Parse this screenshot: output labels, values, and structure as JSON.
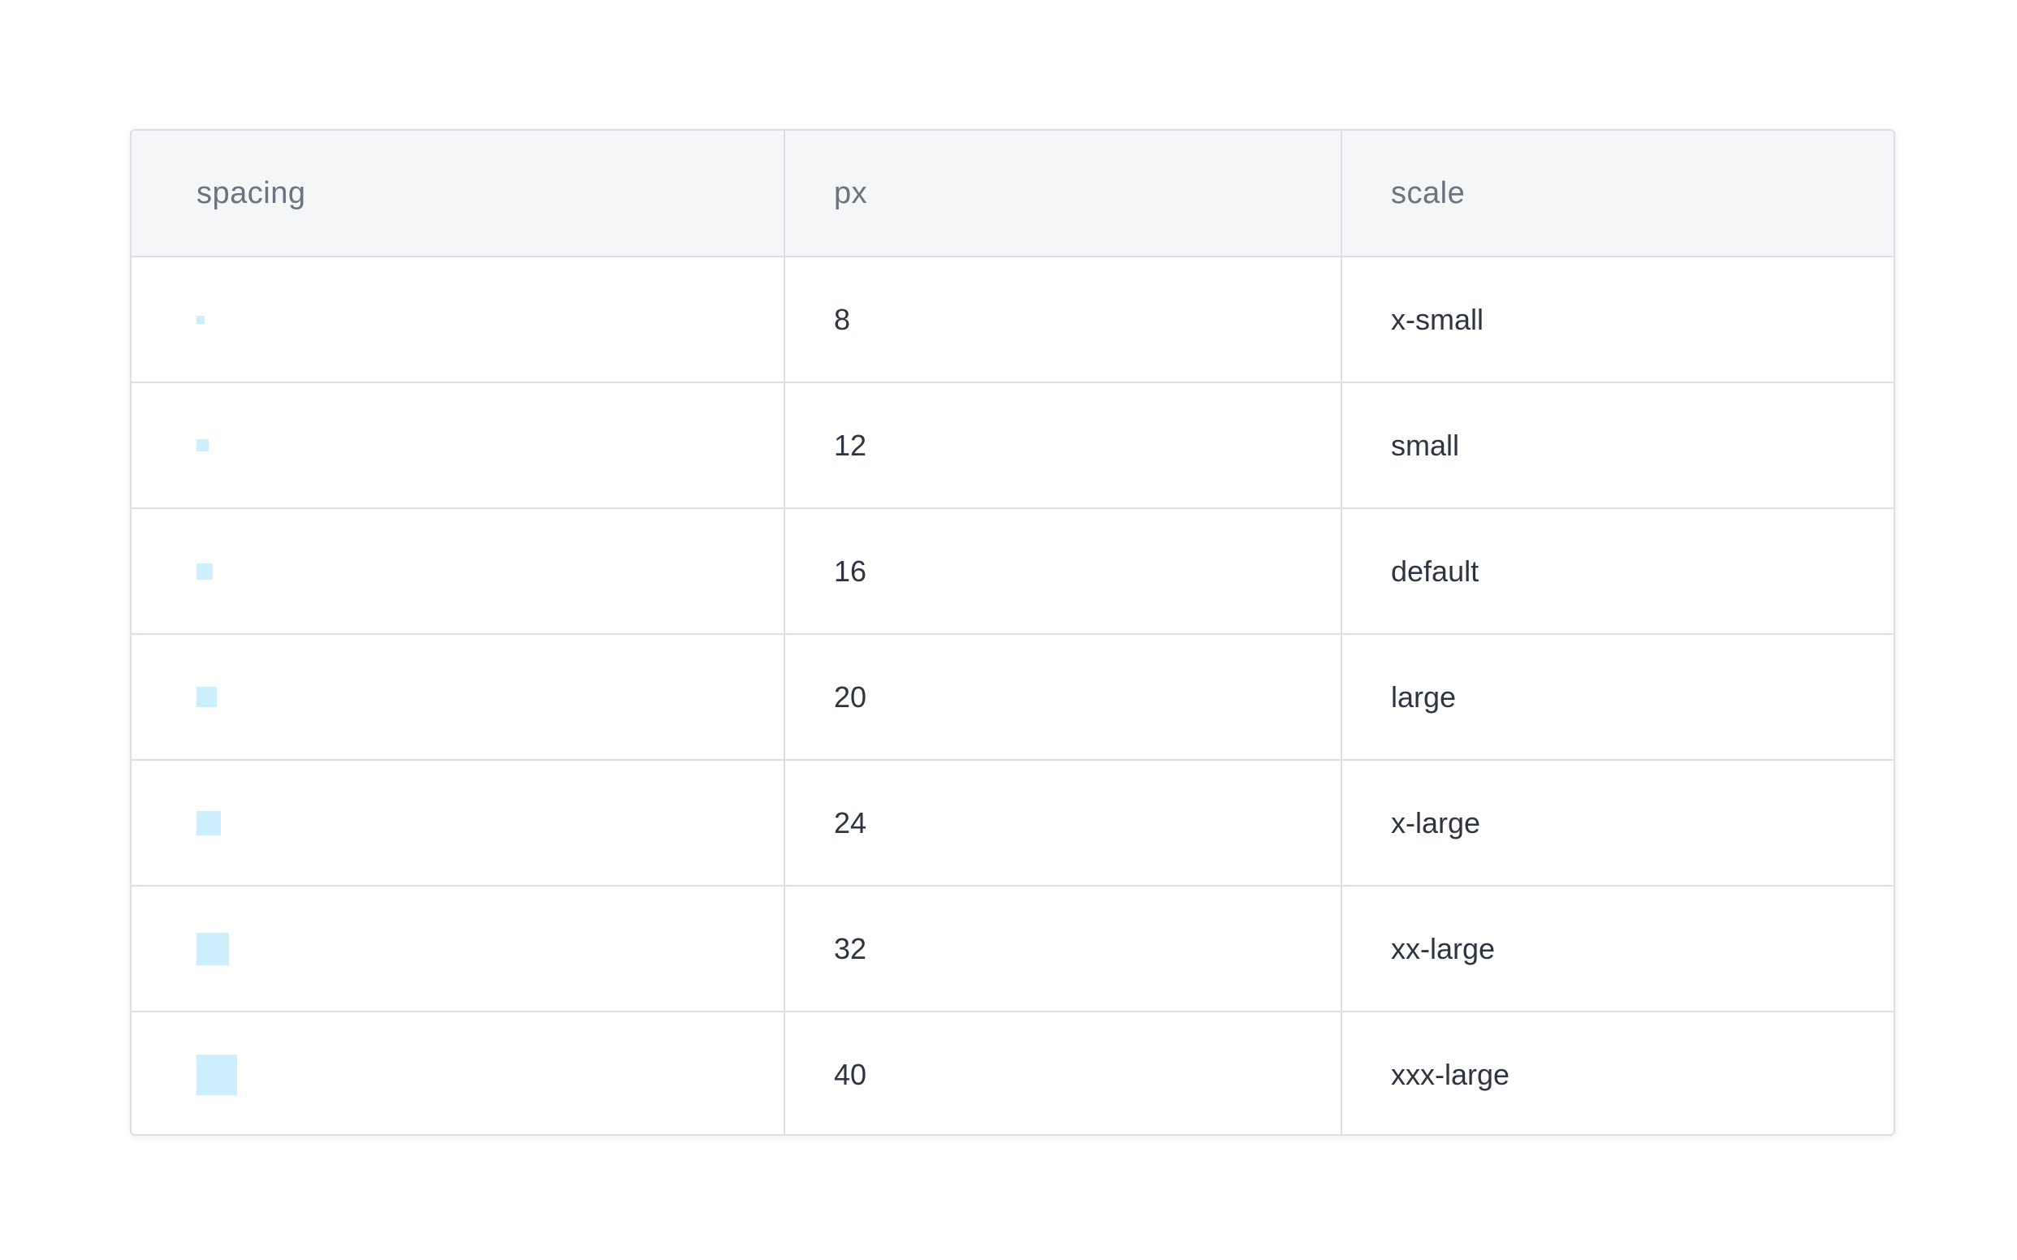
{
  "table": {
    "headers": {
      "spacing": "spacing",
      "px": "px",
      "scale": "scale"
    },
    "swatch_color": "#cdeffd",
    "rows": [
      {
        "px": "8",
        "scale": "x-small"
      },
      {
        "px": "12",
        "scale": "small"
      },
      {
        "px": "16",
        "scale": "default"
      },
      {
        "px": "20",
        "scale": "large"
      },
      {
        "px": "24",
        "scale": "x-large"
      },
      {
        "px": "32",
        "scale": "xx-large"
      },
      {
        "px": "40",
        "scale": "xxx-large"
      }
    ]
  }
}
